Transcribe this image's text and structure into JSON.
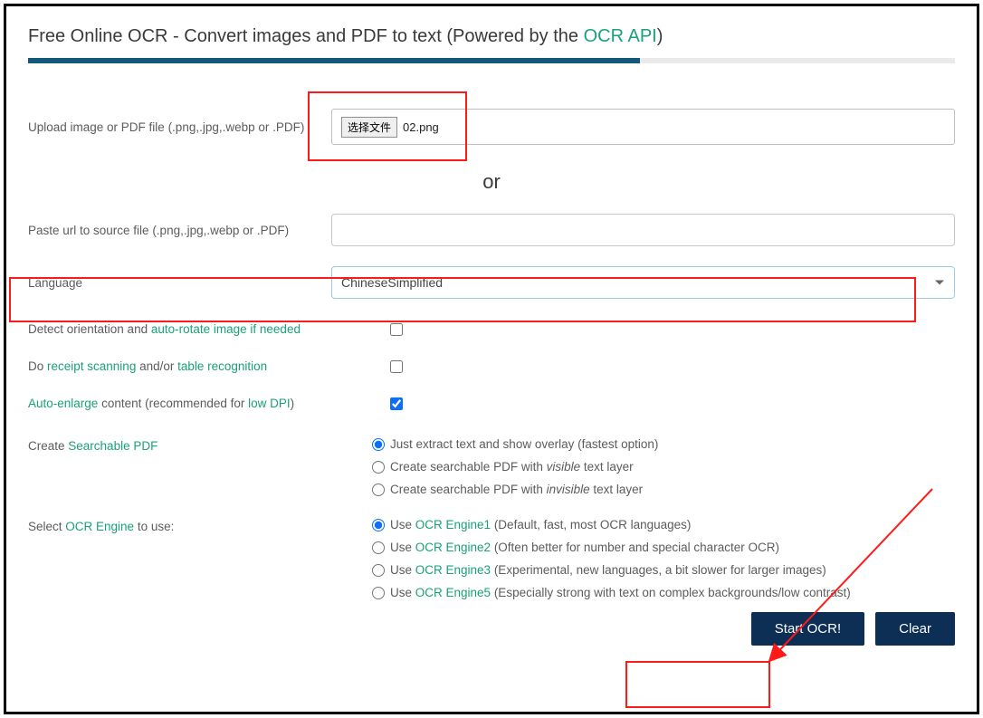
{
  "title": {
    "prefix": "Free Online OCR - Convert images and PDF to text (Powered by the ",
    "link": "OCR API",
    "suffix": ")"
  },
  "progress_pct": 66,
  "upload": {
    "label": "Upload image or PDF file (.png,.jpg,.webp or .PDF)",
    "choose_btn": "选择文件",
    "filename": "02.png"
  },
  "or_text": "or",
  "url_row": {
    "label": "Paste url to source file (.png,.jpg,.webp or .PDF)",
    "value": ""
  },
  "language_row": {
    "label": "Language",
    "value": "ChineseSimplified"
  },
  "detect_row": {
    "pre": "Detect orientation and ",
    "link": "auto-rotate image if needed",
    "checked": false
  },
  "receipt_row": {
    "pre": "Do ",
    "link1": "receipt scanning",
    "mid": " and/or ",
    "link2": "table recognition",
    "checked": false
  },
  "enlarge_row": {
    "link1": "Auto-enlarge",
    "mid": " content (recommended for ",
    "link2": "low DPI",
    "suffix": ")",
    "checked": true
  },
  "pdf_section": {
    "label_pre": "Create ",
    "label_link": "Searchable PDF",
    "options": [
      {
        "text_pre": "Just extract text and show overlay (fastest option)",
        "checked": true
      },
      {
        "text_pre": "Create searchable PDF with ",
        "em": "visible",
        "text_post": " text layer",
        "checked": false
      },
      {
        "text_pre": "Create searchable PDF with ",
        "em": "invisible",
        "text_post": " text layer",
        "checked": false
      }
    ]
  },
  "engine_section": {
    "label_pre": "Select ",
    "label_link": "OCR Engine",
    "label_post": " to use:",
    "options": [
      {
        "pre": "Use ",
        "link": "OCR Engine1",
        "post": " (Default, fast, most OCR languages)",
        "checked": true
      },
      {
        "pre": "Use ",
        "link": "OCR Engine2",
        "post": " (Often better for number and special character OCR)",
        "checked": false
      },
      {
        "pre": "Use ",
        "link": "OCR Engine3",
        "post": " (Experimental, new languages, a bit slower for larger images)",
        "checked": false
      },
      {
        "pre": "Use ",
        "link": "OCR Engine5",
        "post": " (Especially strong with text on complex backgrounds/low contrast)",
        "checked": false
      }
    ]
  },
  "buttons": {
    "start": "Start OCR!",
    "clear": "Clear"
  }
}
